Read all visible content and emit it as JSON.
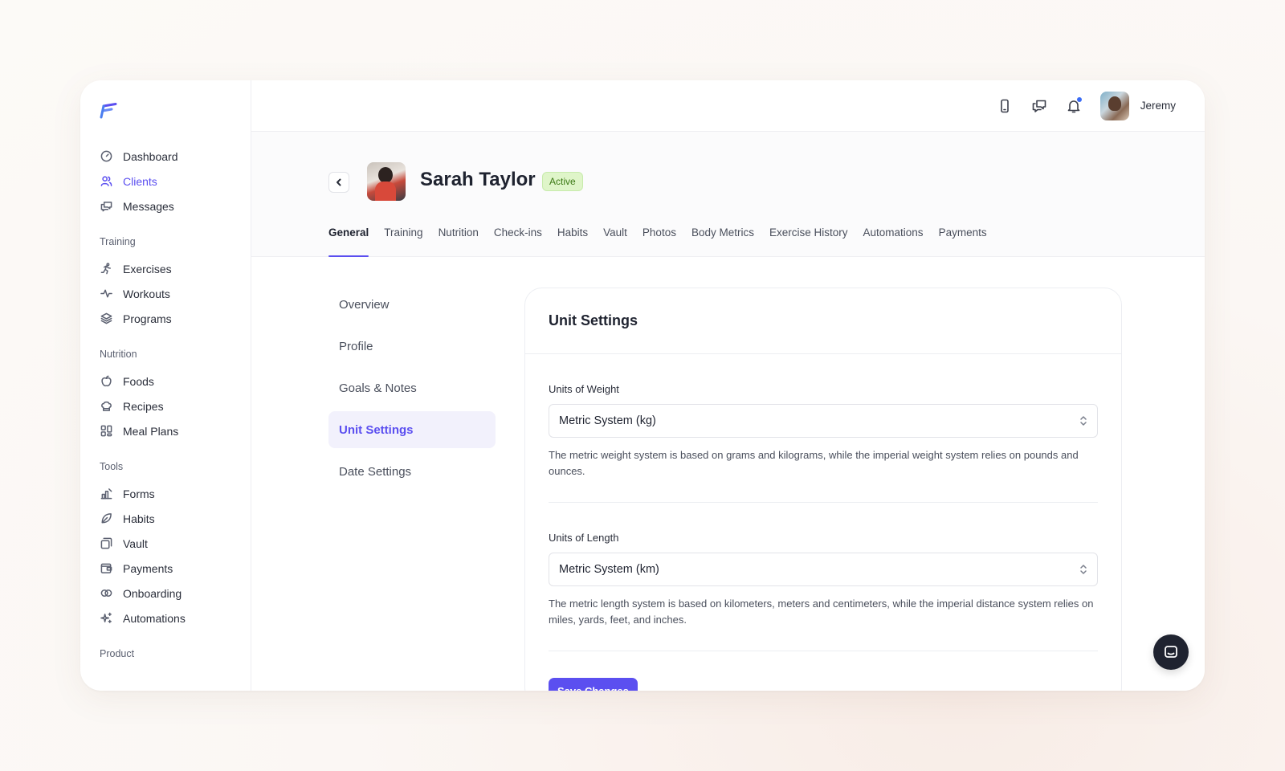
{
  "sidebar": {
    "logo_icon": "logo-icon",
    "main_items": [
      {
        "label": "Dashboard",
        "icon": "dashboard-icon",
        "active": false
      },
      {
        "label": "Clients",
        "icon": "users-icon",
        "active": true
      },
      {
        "label": "Messages",
        "icon": "messages-icon",
        "active": false
      }
    ],
    "groups": [
      {
        "title": "Training",
        "items": [
          {
            "label": "Exercises",
            "icon": "running-icon"
          },
          {
            "label": "Workouts",
            "icon": "pulse-icon"
          },
          {
            "label": "Programs",
            "icon": "layers-icon"
          }
        ]
      },
      {
        "title": "Nutrition",
        "items": [
          {
            "label": "Foods",
            "icon": "apple-icon"
          },
          {
            "label": "Recipes",
            "icon": "chef-hat-icon"
          },
          {
            "label": "Meal Plans",
            "icon": "grid-icon"
          }
        ]
      },
      {
        "title": "Tools",
        "items": [
          {
            "label": "Forms",
            "icon": "forms-icon"
          },
          {
            "label": "Habits",
            "icon": "leaf-icon"
          },
          {
            "label": "Vault",
            "icon": "folder-icon"
          },
          {
            "label": "Payments",
            "icon": "wallet-icon"
          },
          {
            "label": "Onboarding",
            "icon": "links-icon"
          },
          {
            "label": "Automations",
            "icon": "sparkles-icon"
          }
        ]
      },
      {
        "title": "Product",
        "items": []
      }
    ]
  },
  "topbar": {
    "user_name": "Jeremy"
  },
  "client": {
    "name": "Sarah Taylor",
    "status": "Active"
  },
  "tabs": [
    {
      "label": "General",
      "active": true
    },
    {
      "label": "Training"
    },
    {
      "label": "Nutrition"
    },
    {
      "label": "Check-ins"
    },
    {
      "label": "Habits"
    },
    {
      "label": "Vault"
    },
    {
      "label": "Photos"
    },
    {
      "label": "Body Metrics"
    },
    {
      "label": "Exercise History"
    },
    {
      "label": "Automations"
    },
    {
      "label": "Payments"
    }
  ],
  "subnav": [
    {
      "label": "Overview"
    },
    {
      "label": "Profile"
    },
    {
      "label": "Goals & Notes"
    },
    {
      "label": "Unit Settings",
      "active": true
    },
    {
      "label": "Date Settings"
    }
  ],
  "card": {
    "title": "Unit Settings",
    "weight": {
      "label": "Units of Weight",
      "value": "Metric System (kg)",
      "help": "The metric weight system is based on grams and kilograms, while the imperial weight system relies on pounds and ounces."
    },
    "length": {
      "label": "Units of Length",
      "value": "Metric System (km)",
      "help": "The metric length system is based on kilometers, meters and centimeters, while the imperial distance system relies on miles, yards, feet, and inches."
    },
    "save_label": "Save Changes"
  },
  "colors": {
    "accent": "#5b4ff0",
    "badge_bg": "#dff5c9",
    "badge_text": "#3e7a16",
    "notification_dot": "#3b6cf5"
  }
}
